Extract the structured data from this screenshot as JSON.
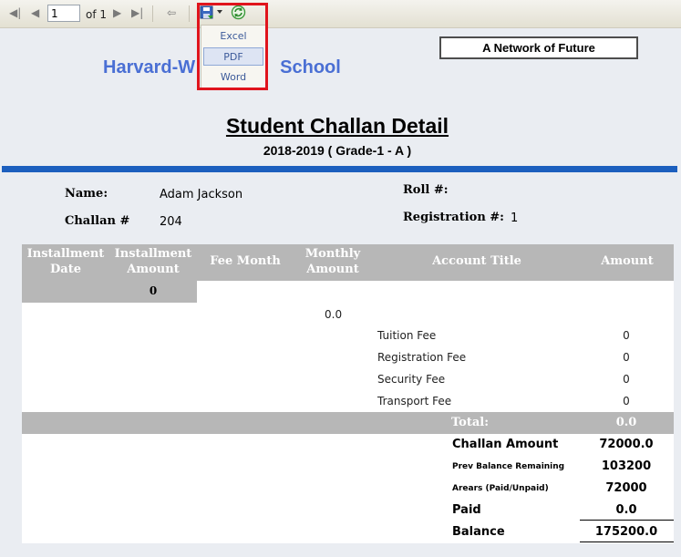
{
  "toolbar": {
    "page_number": "1",
    "page_total_text": "of 1",
    "export_menu": [
      {
        "label": "Excel"
      },
      {
        "label": "PDF"
      },
      {
        "label": "Word"
      }
    ]
  },
  "header": {
    "tagline": "A Network of Future",
    "school_name": "Harvard-W",
    "school_name_end": "School",
    "title": "Student Challan Detail",
    "subtitle": "2018-2019 ( Grade-1 - A )"
  },
  "student": {
    "name_label": "Name:",
    "name_value": "Adam Jackson",
    "challan_label": "Challan #",
    "challan_value": "204",
    "roll_label": "Roll #:",
    "roll_value": "",
    "registration_label": "Registration #:",
    "registration_value": "1"
  },
  "table": {
    "headers": {
      "installment_date": "Installment Date",
      "installment_amount": "Installment Amount",
      "fee_month": "Fee Month",
      "monthly_amount": "Monthly Amount",
      "account_title": "Account Title",
      "amount": "Amount"
    },
    "installment_amount_value": "0",
    "monthly_amount_value": "0.0",
    "fees": [
      {
        "title": "Tuition Fee",
        "amount": "0"
      },
      {
        "title": "Registration Fee",
        "amount": "0"
      },
      {
        "title": "Security Fee",
        "amount": "0"
      },
      {
        "title": "Transport Fee",
        "amount": "0"
      }
    ],
    "total_label": "Total:",
    "total_value": "0.0"
  },
  "summary": {
    "challan_amount_label": "Challan Amount",
    "challan_amount_value": "72000.0",
    "prev_balance_label": "Prev Balance Remaining",
    "prev_balance_value": "103200",
    "arears_label": "Arears (Paid/Unpaid)",
    "arears_value": "72000",
    "paid_label": "Paid",
    "paid_value": "0.0",
    "balance_label": "Balance",
    "balance_value": "175200.0"
  }
}
